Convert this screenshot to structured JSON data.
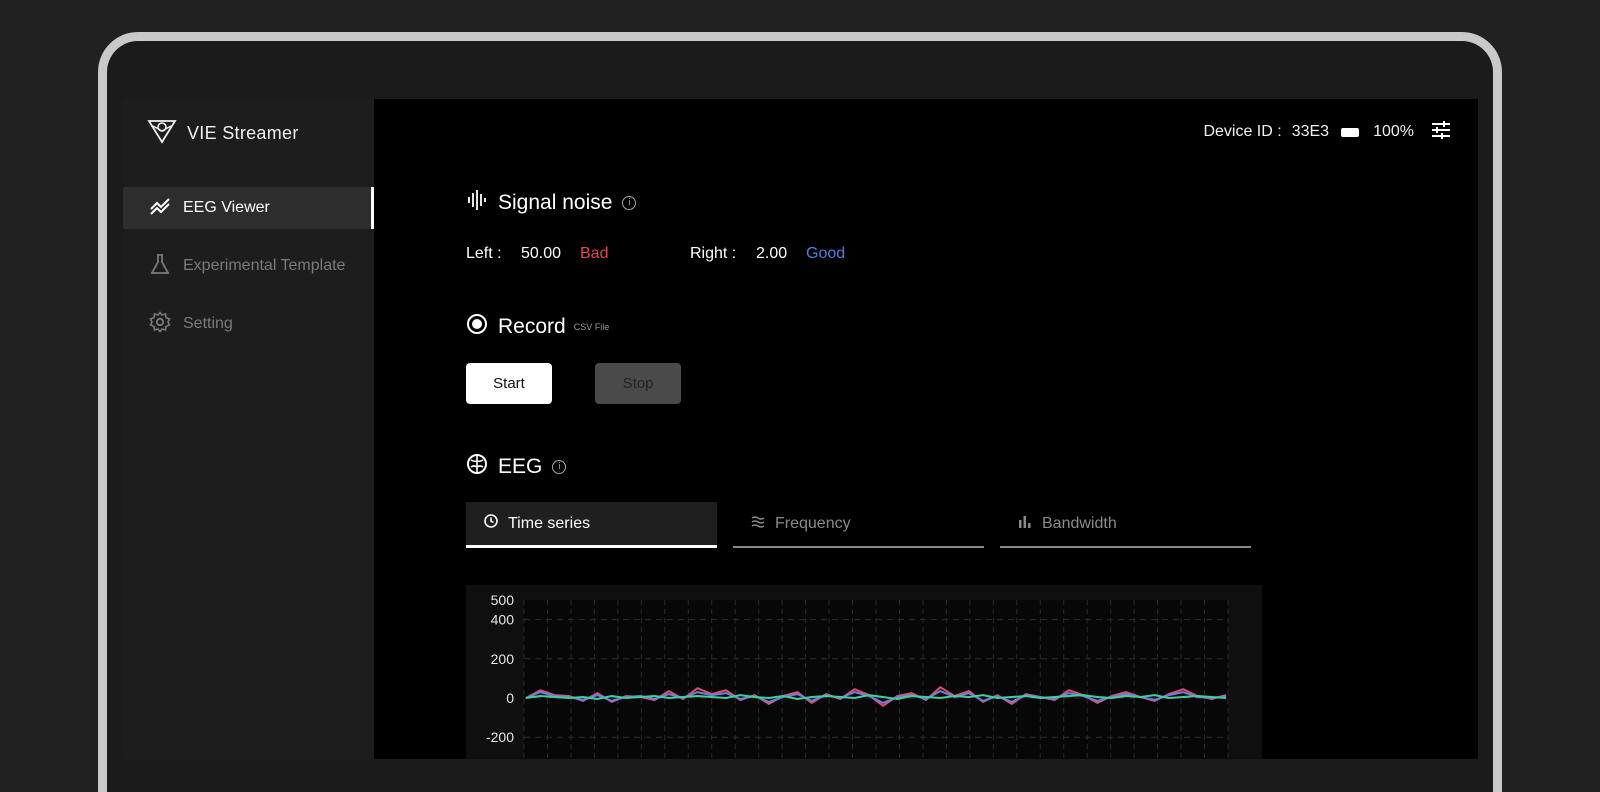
{
  "app": {
    "name": "VIE Streamer"
  },
  "sidebar": {
    "items": [
      {
        "label": "EEG Viewer",
        "icon": "chart-line-icon",
        "active": true
      },
      {
        "label": "Experimental Template",
        "icon": "flask-icon",
        "active": false
      },
      {
        "label": "Setting",
        "icon": "gear-icon",
        "active": false
      }
    ]
  },
  "header": {
    "device_label": "Device ID :",
    "device_id": "33E3",
    "battery": "100%",
    "settings_icon": "sliders-icon"
  },
  "signal_noise": {
    "title": "Signal noise",
    "left_label": "Left :",
    "left_value": "50.00",
    "left_status": "Bad",
    "right_label": "Right :",
    "right_value": "2.00",
    "right_status": "Good",
    "bad_color": "#e0484d",
    "good_color": "#4f7fe6"
  },
  "record": {
    "title": "Record",
    "subtitle": "CSV File",
    "start_label": "Start",
    "stop_label": "Stop"
  },
  "eeg": {
    "title": "EEG",
    "tabs": [
      {
        "label": "Time series",
        "icon": "clock-icon",
        "active": true
      },
      {
        "label": "Frequency",
        "icon": "waves-icon",
        "active": false
      },
      {
        "label": "Bandwidth",
        "icon": "bar-chart-icon",
        "active": false
      }
    ]
  },
  "chart_data": {
    "type": "line",
    "y_ticks": [
      "500",
      "400",
      "200",
      "0",
      "-200"
    ],
    "ylim": [
      -200,
      500
    ],
    "grid": true,
    "series": [
      {
        "color": "#e0506a",
        "values": [
          0,
          40,
          15,
          10,
          -15,
          25,
          -20,
          10,
          5,
          -10,
          35,
          -5,
          50,
          20,
          40,
          -10,
          15,
          -30,
          10,
          30,
          -25,
          20,
          -5,
          45,
          15,
          -40,
          10,
          25,
          -10,
          55,
          10,
          35,
          -20,
          15,
          -30,
          20,
          5,
          -10,
          40,
          15,
          -25,
          10,
          30,
          5,
          -15,
          20,
          45,
          10,
          -5,
          15
        ]
      },
      {
        "color": "#6a7fe0",
        "values": [
          0,
          30,
          10,
          5,
          -10,
          15,
          -15,
          5,
          10,
          -5,
          20,
          0,
          30,
          15,
          25,
          -5,
          10,
          -20,
          5,
          20,
          -15,
          15,
          0,
          30,
          10,
          -25,
          5,
          15,
          -5,
          35,
          5,
          25,
          -15,
          10,
          -20,
          15,
          5,
          -5,
          25,
          10,
          -15,
          5,
          20,
          5,
          -10,
          15,
          30,
          5,
          0,
          10
        ]
      },
      {
        "color": "#3ecf9a",
        "values": [
          0,
          10,
          5,
          0,
          5,
          -5,
          10,
          0,
          5,
          10,
          0,
          5,
          10,
          5,
          0,
          15,
          5,
          0,
          10,
          -5,
          5,
          10,
          5,
          0,
          15,
          5,
          -5,
          10,
          5,
          0,
          10,
          5,
          15,
          0,
          5,
          10,
          0,
          5,
          10,
          15,
          5,
          0,
          10,
          5,
          15,
          0,
          5,
          10,
          5,
          0
        ]
      }
    ]
  }
}
